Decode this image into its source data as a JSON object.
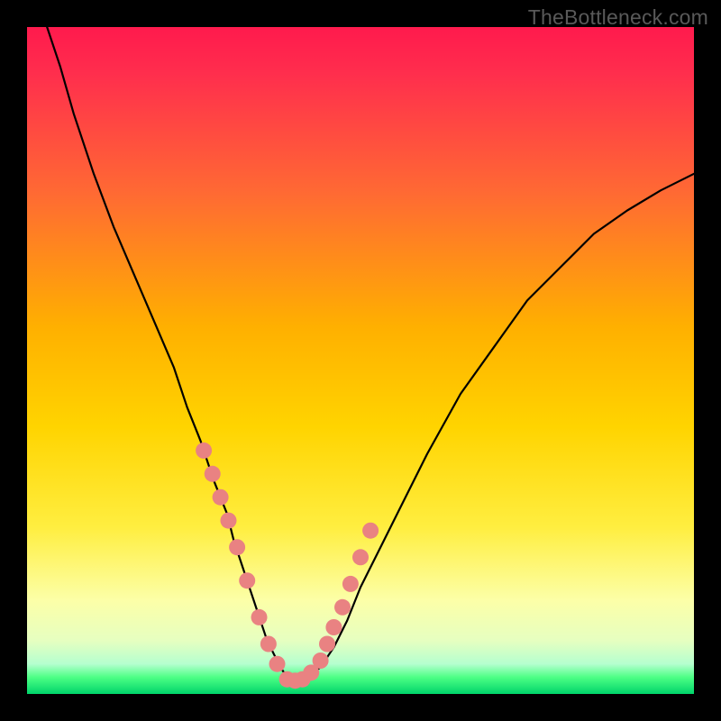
{
  "watermark": "TheBottleneck.com",
  "chart_data": {
    "type": "line",
    "title": "",
    "xlabel": "",
    "ylabel": "",
    "xlim": [
      0,
      100
    ],
    "ylim": [
      0,
      100
    ],
    "grid": false,
    "legend": false,
    "background_gradient": {
      "top": "#ff1a4d",
      "upper_mid": "#ff7a33",
      "mid": "#ffd400",
      "lower_mid": "#fff27a",
      "lower": "#f6ffb8",
      "bottom_band": "#4dff85",
      "bottom": "#00d46a"
    },
    "series": [
      {
        "name": "curve",
        "color": "#000000",
        "x": [
          3,
          5,
          7,
          10,
          13,
          16,
          19,
          22,
          24,
          26,
          28,
          30,
          31,
          32,
          33,
          34,
          35,
          36,
          37,
          38,
          39,
          40,
          42,
          44,
          46,
          48,
          50,
          53,
          56,
          60,
          65,
          70,
          75,
          80,
          85,
          90,
          95,
          100
        ],
        "y": [
          100,
          94,
          87,
          78,
          70,
          63,
          56,
          49,
          43,
          38,
          32,
          27,
          23,
          20,
          17,
          14,
          11,
          8,
          6,
          4,
          2.5,
          2,
          2.5,
          4,
          7,
          11,
          16,
          22,
          28,
          36,
          45,
          52,
          59,
          64,
          69,
          72.5,
          75.5,
          78
        ]
      }
    ],
    "marker_points": {
      "color": "#e98282",
      "radius": 9,
      "x": [
        26.5,
        27.8,
        29.0,
        30.2,
        31.5,
        33.0,
        34.8,
        36.2,
        37.5,
        39.0,
        40.2,
        41.3,
        42.6,
        44.0,
        45.0,
        46.0,
        47.3,
        48.5,
        50.0,
        51.5
      ],
      "y": [
        36.5,
        33.0,
        29.5,
        26.0,
        22.0,
        17.0,
        11.5,
        7.5,
        4.5,
        2.2,
        2.0,
        2.2,
        3.2,
        5.0,
        7.5,
        10.0,
        13.0,
        16.5,
        20.5,
        24.5
      ]
    }
  }
}
